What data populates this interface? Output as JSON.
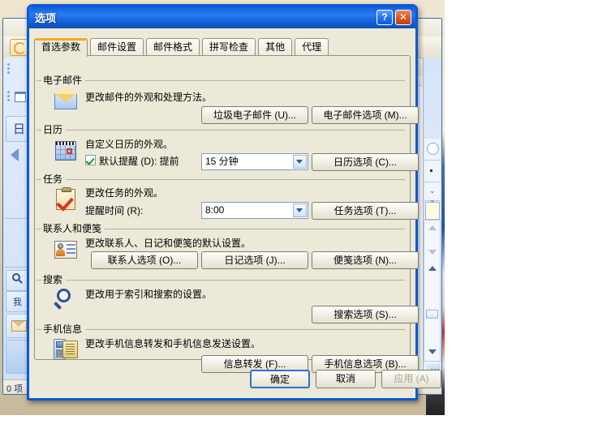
{
  "desktop": {
    "outlook": {
      "status_text": "0 项",
      "nav_letter": "日",
      "nav_label": "我",
      "tabstrip_close": "✕"
    }
  },
  "dialog": {
    "title": "选项",
    "help_button": "?",
    "close_button": "✕",
    "tabs": [
      {
        "label": "首选参数",
        "active": true
      },
      {
        "label": "邮件设置",
        "active": false
      },
      {
        "label": "邮件格式",
        "active": false
      },
      {
        "label": "拼写检查",
        "active": false
      },
      {
        "label": "其他",
        "active": false
      },
      {
        "label": "代理",
        "active": false
      }
    ],
    "groups": {
      "email": {
        "legend": "电子邮件",
        "description": "更改邮件的外观和处理方法。",
        "junk_button": "垃圾电子邮件 (U)...",
        "options_button": "电子邮件选项 (M)..."
      },
      "calendar": {
        "legend": "日历",
        "description": "自定义日历的外观。",
        "reminder_checkbox_label": "默认提醒 (D): 提前",
        "reminder_checked": true,
        "reminder_value": "15 分钟",
        "options_button": "日历选项 (C)..."
      },
      "tasks": {
        "legend": "任务",
        "description": "更改任务的外观。",
        "reminder_time_label": "提醒时间 (R):",
        "reminder_time_value": "8:00",
        "options_button": "任务选项 (T)..."
      },
      "contacts": {
        "legend": "联系人和便笺",
        "description": "更改联系人、日记和便笺的默认设置。",
        "contact_button": "联系人选项 (O)...",
        "journal_button": "日记选项 (J)...",
        "notes_button": "便笺选项 (N)..."
      },
      "search": {
        "legend": "搜索",
        "description": "更改用于索引和搜索的设置。",
        "options_button": "搜索选项 (S)..."
      },
      "mobile": {
        "legend": "手机信息",
        "description": "更改手机信息转发和手机信息发送设置。",
        "forward_button": "信息转发 (F)...",
        "options_button": "手机信息选项 (B)..."
      }
    },
    "footer": {
      "ok_button": "确定",
      "cancel_button": "取消",
      "apply_button": "应用 (A)",
      "apply_disabled": true
    }
  },
  "colors": {
    "title_accent": "#0a5ad6",
    "active_tab_accent": "#f7a828",
    "dialog_face": "#ece9d8",
    "close_button": "#c23c10"
  }
}
